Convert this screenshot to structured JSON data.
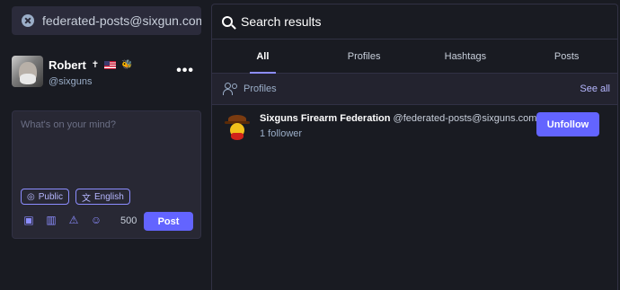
{
  "search": {
    "query": "federated-posts@sixgun.com"
  },
  "account": {
    "display_name": "Robert",
    "emoji_dagger": "✝",
    "emoji_bee": "🐝",
    "handle": "@sixguns",
    "more_label": "•••"
  },
  "compose": {
    "placeholder": "What's on your mind?",
    "visibility": "Public",
    "language": "English",
    "char_count": "500",
    "post_label": "Post"
  },
  "results": {
    "header": "Search results",
    "tabs": [
      "All",
      "Profiles",
      "Hashtags",
      "Posts"
    ],
    "active_tab": "All",
    "section_label": "Profiles",
    "see_all": "See all",
    "profiles": [
      {
        "name": "Sixguns Firearm Federation",
        "acct": "@federated-posts@sixguns.com",
        "followers": "1 follower",
        "action": "Unfollow"
      }
    ]
  },
  "colors": {
    "background": "#191b22",
    "accent": "#6364ff",
    "muted": "#9baec8"
  }
}
